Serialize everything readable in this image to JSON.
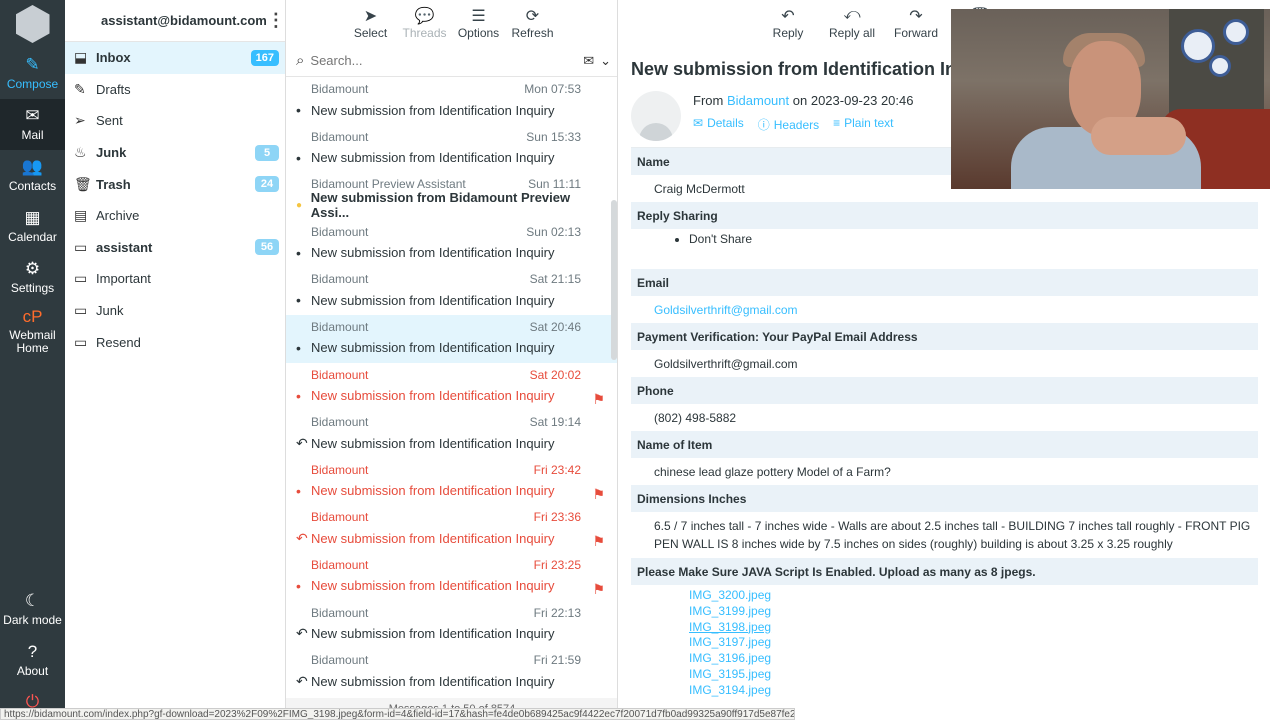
{
  "nav": {
    "compose": "Compose",
    "mail": "Mail",
    "contacts": "Contacts",
    "calendar": "Calendar",
    "settings": "Settings",
    "webmail_home_1": "Webmail",
    "webmail_home_2": "Home",
    "dark_mode": "Dark mode",
    "about": "About"
  },
  "account": {
    "email": "assistant@bidamount.com"
  },
  "folders": [
    {
      "name": "Inbox",
      "count": "167",
      "icon": "inbox-icon",
      "bold": true,
      "selected": true
    },
    {
      "name": "Drafts",
      "count": "",
      "icon": "pencil-icon"
    },
    {
      "name": "Sent",
      "count": "",
      "icon": "paper-plane-icon"
    },
    {
      "name": "Junk",
      "count": "5",
      "icon": "fire-icon",
      "bold": true
    },
    {
      "name": "Trash",
      "count": "24",
      "icon": "trash-icon",
      "bold": true
    },
    {
      "name": "Archive",
      "count": "",
      "icon": "archive-icon"
    },
    {
      "name": "assistant",
      "count": "56",
      "icon": "folder-icon",
      "bold": true
    },
    {
      "name": "Important",
      "count": "",
      "icon": "folder-icon"
    },
    {
      "name": "Junk",
      "count": "",
      "icon": "folder-icon"
    },
    {
      "name": "Resend",
      "count": "",
      "icon": "folder-icon"
    }
  ],
  "list_toolbar": {
    "select": "Select",
    "threads": "Threads",
    "options": "Options",
    "refresh": "Refresh"
  },
  "search": {
    "placeholder": "Search..."
  },
  "messages": [
    {
      "from": "Bidamount",
      "date": "Mon 07:53",
      "subject": "New submission from Identification Inquiry",
      "status": "dot"
    },
    {
      "from": "Bidamount",
      "date": "Sun 15:33",
      "subject": "New submission from Identification Inquiry",
      "status": "dot"
    },
    {
      "from": "Bidamount Preview Assistant",
      "date": "Sun 11:11",
      "subject": "New submission from Bidamount Preview Assi...",
      "status": "unread"
    },
    {
      "from": "Bidamount",
      "date": "Sun 02:13",
      "subject": "New submission from Identification Inquiry",
      "status": "dot"
    },
    {
      "from": "Bidamount",
      "date": "Sat 21:15",
      "subject": "New submission from Identification Inquiry",
      "status": "dot"
    },
    {
      "from": "Bidamount",
      "date": "Sat 20:46",
      "subject": "New submission from Identification Inquiry",
      "status": "dot",
      "selected": true
    },
    {
      "from": "Bidamount",
      "date": "Sat 20:02",
      "subject": "New submission from Identification Inquiry",
      "status": "dot",
      "flagged": true
    },
    {
      "from": "Bidamount",
      "date": "Sat 19:14",
      "subject": "New submission from Identification Inquiry",
      "status": "replied"
    },
    {
      "from": "Bidamount",
      "date": "Fri 23:42",
      "subject": "New submission from Identification Inquiry",
      "status": "dot",
      "flagged": true
    },
    {
      "from": "Bidamount",
      "date": "Fri 23:36",
      "subject": "New submission from Identification Inquiry",
      "status": "replied",
      "flagged": true
    },
    {
      "from": "Bidamount",
      "date": "Fri 23:25",
      "subject": "New submission from Identification Inquiry",
      "status": "dot",
      "flagged": true
    },
    {
      "from": "Bidamount",
      "date": "Fri 22:13",
      "subject": "New submission from Identification Inquiry",
      "status": "replied"
    },
    {
      "from": "Bidamount",
      "date": "Fri 21:59",
      "subject": "New submission from Identification Inquiry",
      "status": "replied"
    }
  ],
  "reader_toolbar": {
    "reply": "Reply",
    "reply_all": "Reply all",
    "forward": "Forward",
    "delete": "De"
  },
  "email": {
    "subject": "New submission from Identification Inquiry",
    "from_label": "From",
    "from_name": "Bidamount",
    "on_label": "on",
    "datetime": "2023-09-23 20:46",
    "details": "Details",
    "headers": "Headers",
    "plain_text": "Plain text"
  },
  "form": {
    "name_label": "Name",
    "name_value": "Craig McDermott",
    "reply_sharing_label": "Reply Sharing",
    "reply_sharing_value": "Don't Share",
    "email_label": "Email",
    "email_value": "Goldsilverthrift@gmail.com",
    "paypal_label": "Payment Verification: Your PayPal Email Address",
    "paypal_value": "Goldsilverthrift@gmail.com",
    "phone_label": "Phone",
    "phone_value": "(802) 498-5882",
    "item_label": "Name of Item",
    "item_value": "chinese lead glaze pottery Model of a Farm?",
    "dimensions_label": "Dimensions Inches",
    "dimensions_value": "6.5 / 7 inches tall - 7 inches wide - Walls are about 2.5 inches tall - BUILDING 7 inches tall roughly - FRONT PIG PEN WALL IS 8 inches wide by 7.5 inches on sides (roughly) building is about 3.25 x 3.25 roughly",
    "upload_label": "Please Make Sure JAVA Script Is Enabled. Upload as many as 8 jpegs.",
    "files": [
      "IMG_3200.jpeg",
      "IMG_3199.jpeg",
      "IMG_3198.jpeg",
      "IMG_3197.jpeg",
      "IMG_3196.jpeg",
      "IMG_3195.jpeg",
      "IMG_3194.jpeg"
    ]
  },
  "status_url": "https://bidamount.com/index.php?gf-download=2023%2F09%2FIMG_3198.jpeg&form-id=4&field-id=17&hash=fe4de0b689425ac9f4422ec7f20071d7fb0ad99325a90ff917d5e87fe22612ff",
  "pager": "Messages 1 to 50 of 8574"
}
